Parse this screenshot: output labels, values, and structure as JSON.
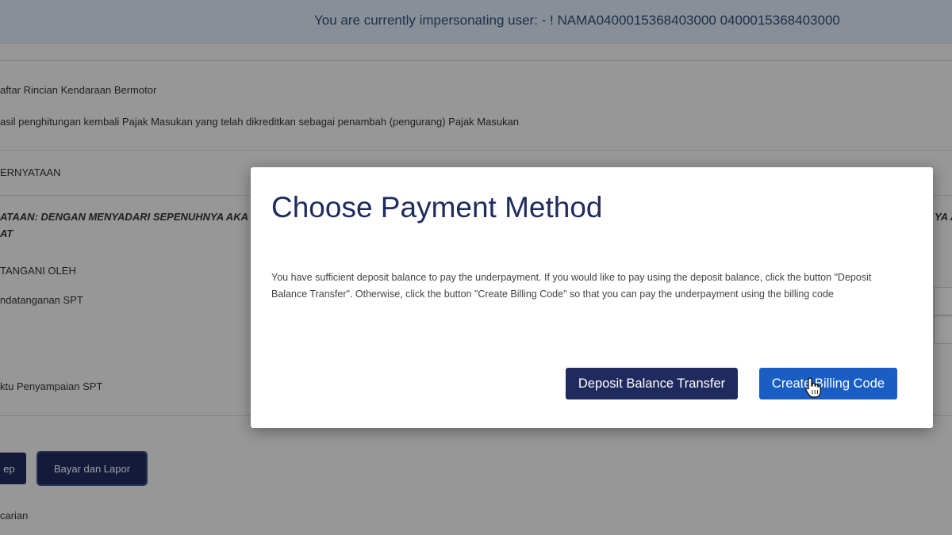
{
  "banner": {
    "text": "You are currently impersonating user: - ! NAMA0400015368403000 0400015368403000"
  },
  "background": {
    "line1": "aftar Rincian Kendaraan Bermotor",
    "line2": "asil penghitungan kembali Pajak Masukan yang telah dikreditkan sebagai penambah (pengurang) Pajak Masukan",
    "line3": "ERNYATAAN",
    "line4a": "ATAAN: DENGAN MENYADARI SEPENUHNYA AKA",
    "line4b": "AT",
    "line4c": "YA A",
    "line5": "TANGANI OLEH",
    "line6": "ndatanganan SPT",
    "line7": "ktu Penyampaian SPT",
    "btn_prev": "ep",
    "btn_pay": "Bayar dan Lapor",
    "footer": "carian"
  },
  "modal": {
    "title": "Choose Payment Method",
    "body": "You have sufficient deposit balance to pay the underpayment. If you would like to pay using the deposit balance, click the button \"Deposit Balance Transfer\". Otherwise, click the button \"Create Billing Code\" so that you can pay the underpayment using the billing code",
    "deposit_button": "Deposit Balance Transfer",
    "billing_button": "Create Billing Code"
  },
  "colors": {
    "primary_navy": "#1f2b5e",
    "primary_blue": "#1a5ec4",
    "banner_bg": "#dbe7f5",
    "banner_text": "#2a4f7d"
  },
  "icons": {
    "cursor": "hand-pointer-icon"
  }
}
